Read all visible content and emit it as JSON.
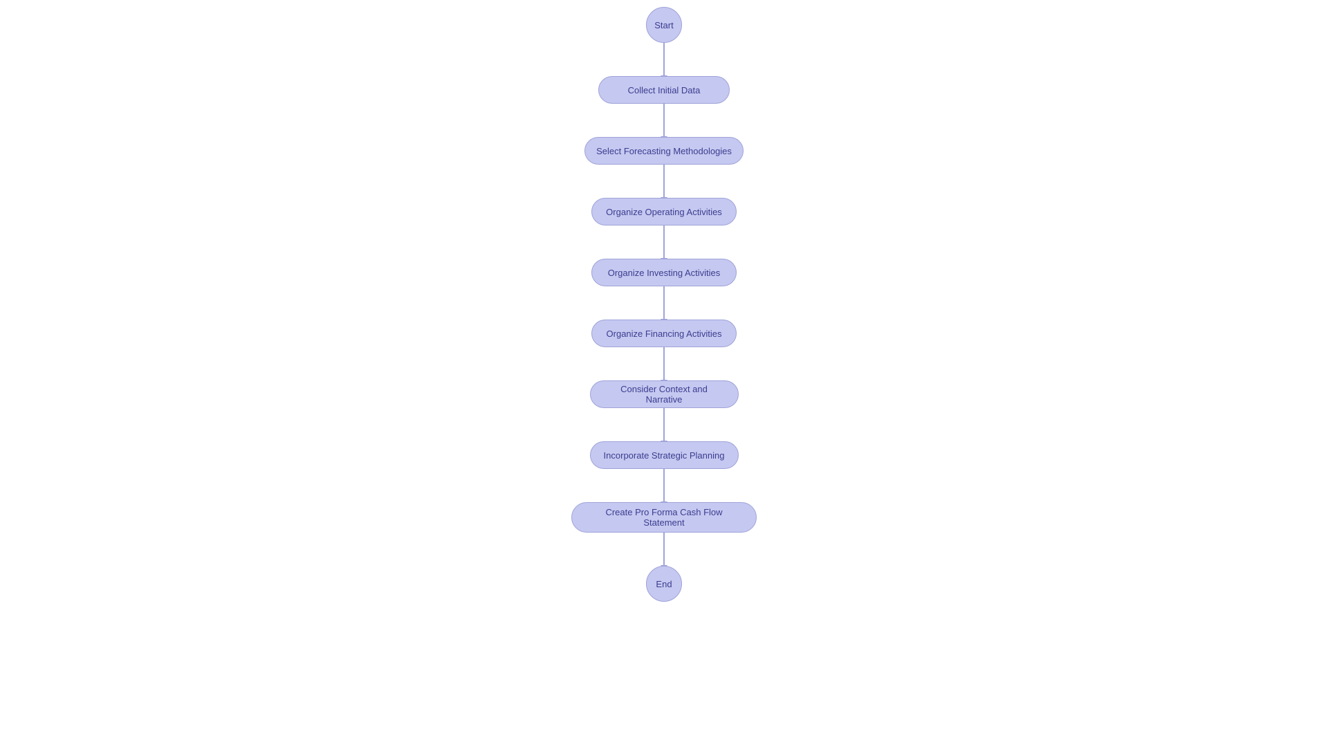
{
  "flowchart": {
    "nodes": [
      {
        "id": "start",
        "label": "Start",
        "type": "circle"
      },
      {
        "id": "collect-initial-data",
        "label": "Collect Initial Data",
        "type": "wide"
      },
      {
        "id": "select-forecasting",
        "label": "Select Forecasting Methodologies",
        "type": "wider"
      },
      {
        "id": "organize-operating",
        "label": "Organize Operating Activities",
        "type": "wider"
      },
      {
        "id": "organize-investing",
        "label": "Organize Investing Activities",
        "type": "wider"
      },
      {
        "id": "organize-financing",
        "label": "Organize Financing Activities",
        "type": "wider"
      },
      {
        "id": "consider-context",
        "label": "Consider Context and Narrative",
        "type": "wider"
      },
      {
        "id": "incorporate-strategic",
        "label": "Incorporate Strategic Planning",
        "type": "wider"
      },
      {
        "id": "create-pro-forma",
        "label": "Create Pro Forma Cash Flow Statement",
        "type": "widest"
      },
      {
        "id": "end",
        "label": "End",
        "type": "circle"
      }
    ],
    "colors": {
      "node_bg": "#c5c8f0",
      "node_border": "#9fa3d9",
      "node_text": "#3a3d8f",
      "connector": "#9fa3d9"
    }
  }
}
